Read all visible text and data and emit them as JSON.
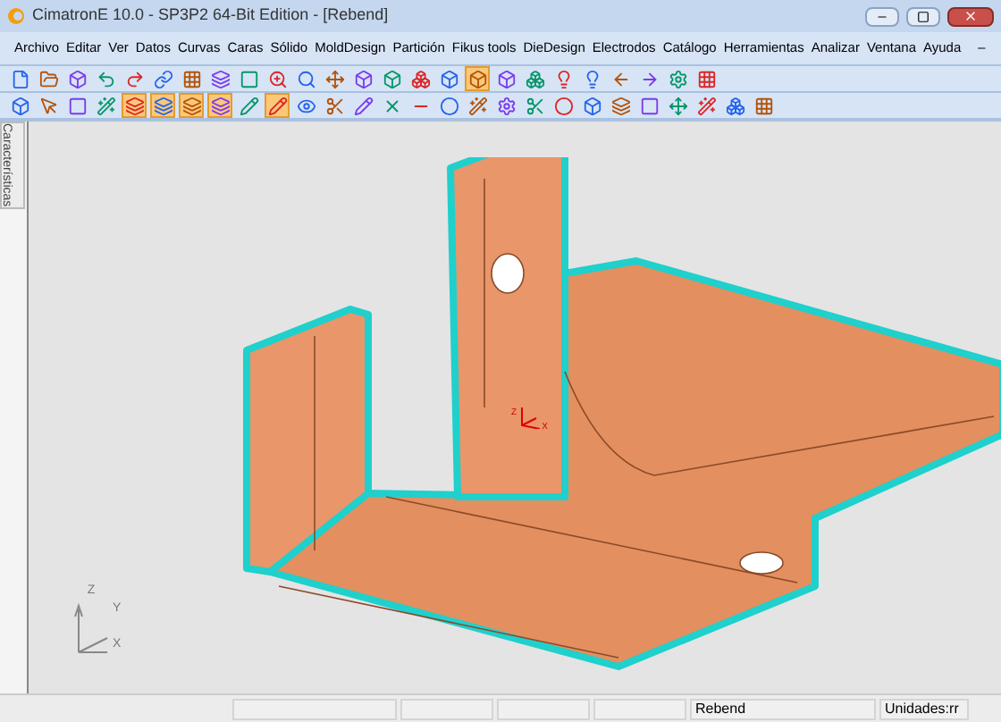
{
  "window": {
    "title": "CimatronE 10.0 - SP3P2 64-Bit Edition - [Rebend]"
  },
  "menu": [
    "Archivo",
    "Editar",
    "Ver",
    "Datos",
    "Curvas",
    "Caras",
    "Sólido",
    "MoldDesign",
    "Partición",
    "Fikus tools",
    "DieDesign",
    "Electrodos",
    "Catálogo",
    "Herramientas",
    "Analizar",
    "Ventana",
    "Ayuda"
  ],
  "toolbars": [
    {
      "buttons": [
        {
          "selected": false
        },
        {
          "selected": false
        },
        {
          "selected": false
        },
        {
          "selected": false
        },
        {
          "selected": false
        },
        {
          "selected": false
        },
        {
          "selected": false
        },
        {
          "selected": false
        },
        {
          "selected": false
        },
        {
          "selected": false
        },
        {
          "selected": false
        },
        {
          "selected": false
        },
        {
          "selected": false
        },
        {
          "selected": false
        },
        {
          "selected": false
        },
        {
          "selected": false
        },
        {
          "selected": true
        },
        {
          "selected": false
        },
        {
          "selected": false
        },
        {
          "selected": false
        },
        {
          "selected": false
        },
        {
          "selected": false
        },
        {
          "selected": false
        },
        {
          "selected": false
        },
        {
          "selected": false
        }
      ]
    },
    {
      "buttons": [
        {
          "selected": false
        },
        {
          "selected": false
        },
        {
          "selected": false
        },
        {
          "selected": false
        },
        {
          "selected": true
        },
        {
          "selected": true
        },
        {
          "selected": true
        },
        {
          "selected": true
        },
        {
          "selected": false
        },
        {
          "selected": true
        },
        {
          "selected": false
        },
        {
          "selected": false
        },
        {
          "selected": false
        },
        {
          "selected": false
        },
        {
          "selected": false
        },
        {
          "selected": false
        },
        {
          "selected": false
        },
        {
          "selected": false
        },
        {
          "selected": false
        },
        {
          "selected": false
        },
        {
          "selected": false
        },
        {
          "selected": false
        },
        {
          "selected": false
        },
        {
          "selected": false
        },
        {
          "selected": false
        },
        {
          "selected": false
        },
        {
          "selected": false
        }
      ]
    }
  ],
  "side_tab": {
    "label": "Características"
  },
  "viewport": {
    "axes": {
      "z": "Z",
      "y": "Y",
      "x": "X"
    },
    "origin_axes": {
      "z": "Z",
      "x": "X"
    }
  },
  "status_bar": [
    "Rebend",
    "Unidades:rr"
  ]
}
